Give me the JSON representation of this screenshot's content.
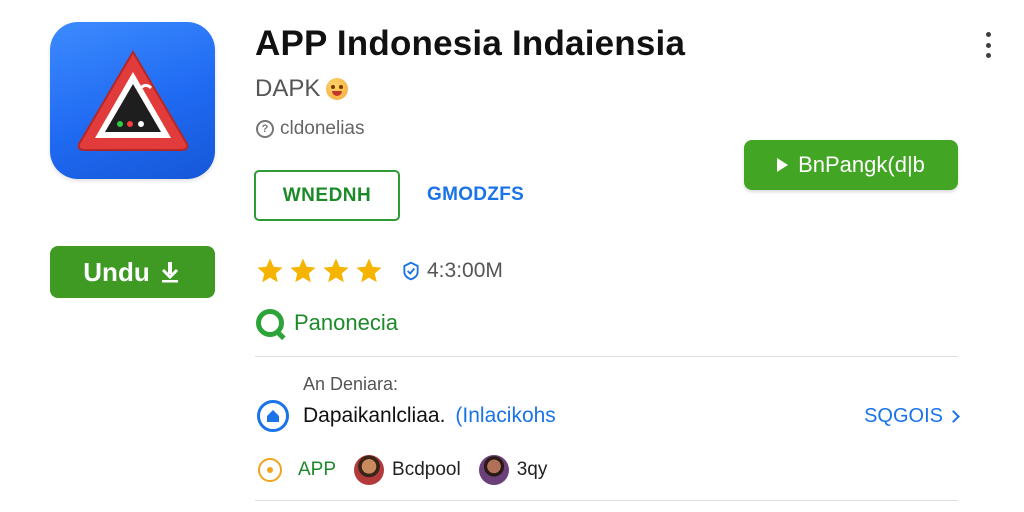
{
  "header": {
    "title": "APP Indonesia Indaiensia",
    "developer": "DAPK",
    "location": "cldonelias"
  },
  "icons": {
    "app_icon": "warning-triangle-app-icon",
    "more": "more-vert-icon",
    "download": "download-icon",
    "play": "play-icon",
    "info": "info-icon",
    "emoji": "emoji-icon",
    "badge": "verified-badge-icon",
    "category": "q-icon",
    "home": "home-icon",
    "chevron": "chevron-right-icon",
    "target": "target-icon"
  },
  "buttons": {
    "download_label": "Undu",
    "primary_label": "BnPangk(d|b",
    "outline_label": "WNEDNH",
    "link_label": "GMODZFS"
  },
  "rating": {
    "stars": 4,
    "reviews_text": "4:3:00M"
  },
  "category": {
    "label": "Panonecia"
  },
  "section": {
    "label": "An Deniara:",
    "title": "Dapaikanlcliaa.",
    "subtitle": "(Inlacikohs",
    "see_more": "SQGOIS"
  },
  "bottom": {
    "tag": "APP",
    "people": [
      {
        "name": "Bcdpool"
      },
      {
        "name": "3qy"
      }
    ]
  },
  "colors": {
    "green_button": "#3e9a22",
    "accent_green": "#1d8a2a",
    "accent_blue": "#1a73e8",
    "star": "#f5b400",
    "icon_blue": "#1f6af2"
  }
}
